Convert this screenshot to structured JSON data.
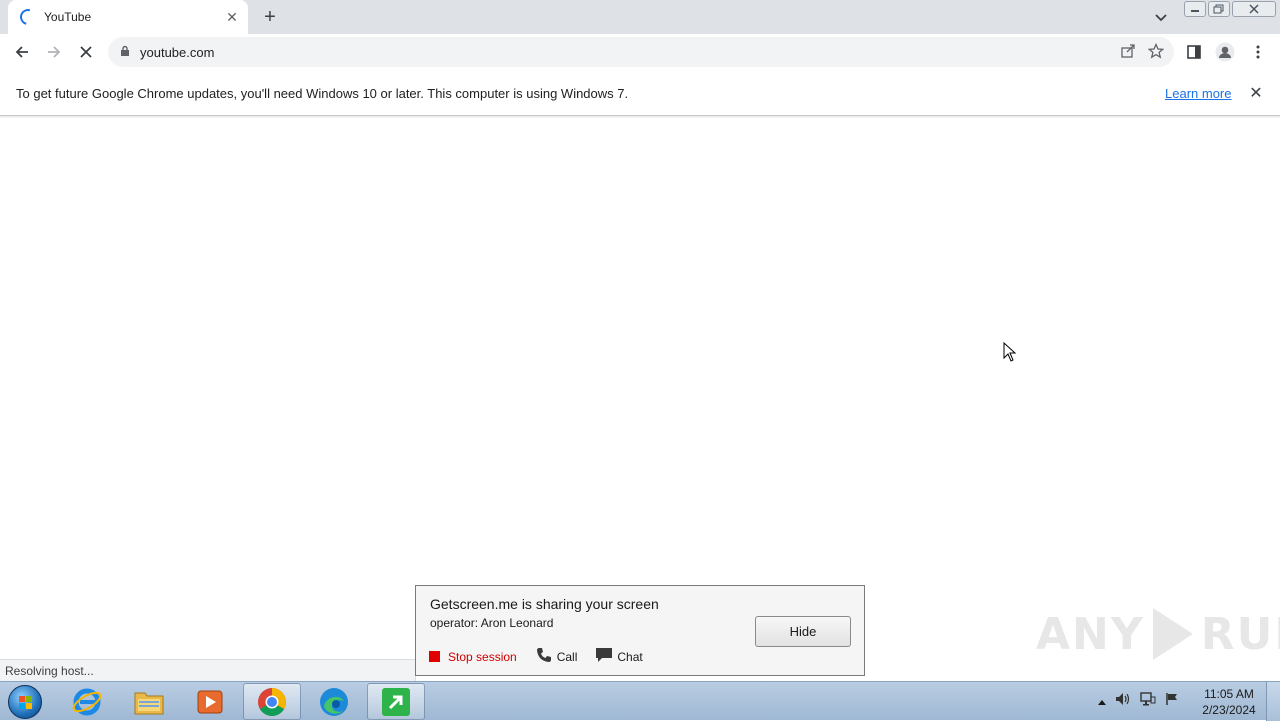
{
  "browser": {
    "tab": {
      "title": "YouTube"
    },
    "omnibox": {
      "url": "youtube.com"
    },
    "infobar": {
      "message": "To get future Google Chrome updates, you'll need Windows 10 or later. This computer is using Windows 7.",
      "link": "Learn more"
    },
    "status": "Resolving host..."
  },
  "getscreen": {
    "title": "Getscreen.me is sharing your screen",
    "operator": "operator: Aron Leonard",
    "stop_label": "Stop session",
    "call_label": "Call",
    "chat_label": "Chat",
    "hide_label": "Hide"
  },
  "watermark": {
    "left": "ANY",
    "right": "RUN"
  },
  "taskbar": {
    "apps": [
      "internet-explorer-icon",
      "explorer-folder-icon",
      "media-player-icon",
      "chrome-icon",
      "edge-icon",
      "getscreen-icon"
    ],
    "clock": {
      "time": "11:05 AM",
      "date": "2/23/2024"
    }
  },
  "colors": {
    "accent": "#1a73e8",
    "stop": "#e00000",
    "tabstrip": "#dee1e6"
  }
}
